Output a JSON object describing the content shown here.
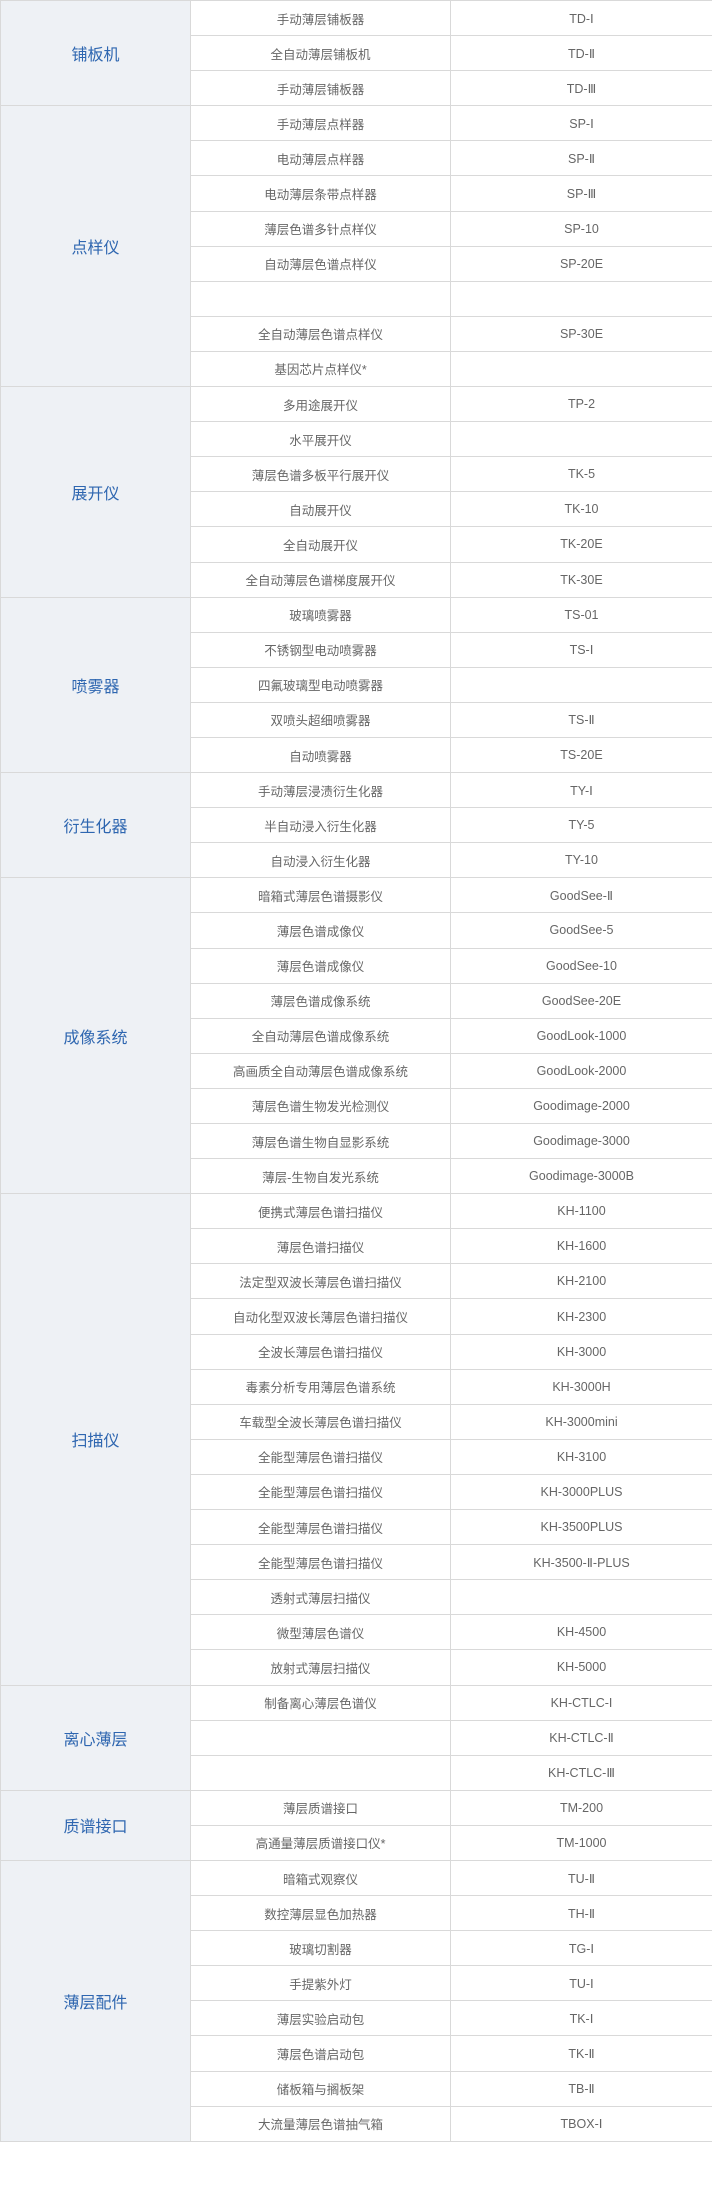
{
  "groups": [
    {
      "category": "铺板机",
      "items": [
        [
          "手动薄层铺板器",
          "TD-Ⅰ"
        ],
        [
          "全自动薄层铺板机",
          "TD-Ⅱ"
        ],
        [
          "手动薄层铺板器",
          "TD-Ⅲ"
        ]
      ]
    },
    {
      "category": "点样仪",
      "items": [
        [
          "手动薄层点样器",
          "SP-Ⅰ"
        ],
        [
          "电动薄层点样器",
          "SP-Ⅱ"
        ],
        [
          "电动薄层条带点样器",
          "SP-Ⅲ"
        ],
        [
          "薄层色谱多针点样仪",
          "SP-10"
        ],
        [
          "自动薄层色谱点样仪",
          "SP-20E"
        ],
        [
          "",
          ""
        ],
        [
          "全自动薄层色谱点样仪",
          "SP-30E"
        ],
        [
          "基因芯片点样仪*",
          ""
        ]
      ]
    },
    {
      "category": "展开仪",
      "items": [
        [
          "多用途展开仪",
          "TP-2"
        ],
        [
          "水平展开仪",
          ""
        ],
        [
          "薄层色谱多板平行展开仪",
          "TK-5"
        ],
        [
          "自动展开仪",
          "TK-10"
        ],
        [
          "全自动展开仪",
          "TK-20E"
        ],
        [
          "全自动薄层色谱梯度展开仪",
          "TK-30E"
        ]
      ]
    },
    {
      "category": "喷雾器",
      "items": [
        [
          "玻璃喷雾器",
          "TS-01"
        ],
        [
          "不锈钢型电动喷雾器",
          "TS-Ⅰ"
        ],
        [
          "四氟玻璃型电动喷雾器",
          ""
        ],
        [
          "双喷头超细喷雾器",
          "TS-Ⅱ"
        ],
        [
          "自动喷雾器",
          "TS-20E"
        ]
      ]
    },
    {
      "category": "衍生化器",
      "items": [
        [
          "手动薄层浸渍衍生化器",
          "TY-Ⅰ"
        ],
        [
          "半自动浸入衍生化器",
          "TY-5"
        ],
        [
          "自动浸入衍生化器",
          "TY-10"
        ]
      ]
    },
    {
      "category": "成像系统",
      "items": [
        [
          "暗箱式薄层色谱摄影仪",
          "GoodSee-Ⅱ"
        ],
        [
          "薄层色谱成像仪",
          "GoodSee-5"
        ],
        [
          "薄层色谱成像仪",
          "GoodSee-10"
        ],
        [
          "薄层色谱成像系统",
          "GoodSee-20E"
        ],
        [
          "全自动薄层色谱成像系统",
          "GoodLook-1000"
        ],
        [
          "高画质全自动薄层色谱成像系统",
          "GoodLook-2000"
        ],
        [
          "薄层色谱生物发光检测仪",
          "Goodimage-2000"
        ],
        [
          "薄层色谱生物自显影系统",
          "Goodimage-3000"
        ],
        [
          "薄层-生物自发光系统",
          "Goodimage-3000B"
        ]
      ]
    },
    {
      "category": "扫描仪",
      "items": [
        [
          "便携式薄层色谱扫描仪",
          "KH-1100"
        ],
        [
          "薄层色谱扫描仪",
          "KH-1600"
        ],
        [
          "法定型双波长薄层色谱扫描仪",
          "KH-2100"
        ],
        [
          "自动化型双波长薄层色谱扫描仪",
          "KH-2300"
        ],
        [
          "全波长薄层色谱扫描仪",
          "KH-3000"
        ],
        [
          "毒素分析专用薄层色谱系统",
          "KH-3000H"
        ],
        [
          "车载型全波长薄层色谱扫描仪",
          "KH-3000mini"
        ],
        [
          "全能型薄层色谱扫描仪",
          "KH-3100"
        ],
        [
          "全能型薄层色谱扫描仪",
          "KH-3000PLUS"
        ],
        [
          "全能型薄层色谱扫描仪",
          "KH-3500PLUS"
        ],
        [
          "全能型薄层色谱扫描仪",
          "KH-3500-Ⅱ-PLUS"
        ],
        [
          "透射式薄层扫描仪",
          ""
        ],
        [
          "微型薄层色谱仪",
          "KH-4500"
        ],
        [
          "放射式薄层扫描仪",
          "KH-5000"
        ]
      ]
    },
    {
      "category": "离心薄层",
      "items": [
        [
          "制备离心薄层色谱仪",
          "KH-CTLC-I"
        ],
        [
          "",
          "KH-CTLC-Ⅱ"
        ],
        [
          "",
          "KH-CTLC-Ⅲ"
        ]
      ]
    },
    {
      "category": "质谱接口",
      "items": [
        [
          "薄层质谱接口",
          "TM-200"
        ],
        [
          "高通量薄层质谱接口仪*",
          "TM-1000"
        ]
      ]
    },
    {
      "category": "薄层配件",
      "items": [
        [
          "暗箱式观察仪",
          "TU-Ⅱ"
        ],
        [
          "数控薄层显色加热器",
          "TH-Ⅱ"
        ],
        [
          "玻璃切割器",
          "TG-Ⅰ"
        ],
        [
          "手提紫外灯",
          "TU-Ⅰ"
        ],
        [
          "薄层实验启动包",
          "TK-Ⅰ"
        ],
        [
          "薄层色谱启动包",
          "TK-Ⅱ"
        ],
        [
          "储板箱与搁板架",
          "TB-Ⅱ"
        ],
        [
          "大流量薄层色谱抽气箱",
          "TBOX-Ⅰ"
        ]
      ]
    }
  ]
}
